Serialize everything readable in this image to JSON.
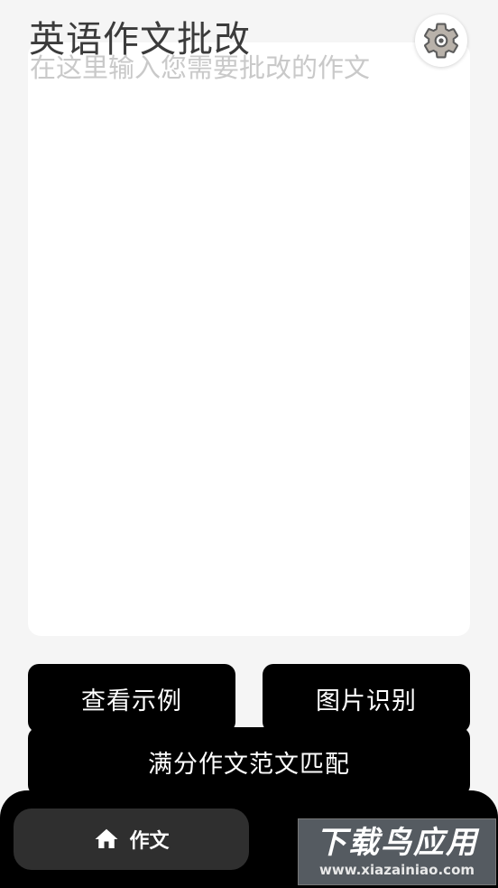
{
  "header": {
    "title": "英语作文批改",
    "settings_icon": "gear-icon"
  },
  "editor": {
    "placeholder": "在这里输入您需要批改的作文",
    "value": ""
  },
  "actions": {
    "example_label": "查看示例",
    "ocr_label": "图片识别",
    "match_label": "满分作文范文匹配"
  },
  "tabbar": {
    "active_tab": {
      "label": "作文",
      "icon": "home-icon"
    }
  },
  "watermark": {
    "title": "下载鸟应用",
    "url": "www.xiazainiao.com"
  },
  "colors": {
    "background": "#f5f5f5",
    "button": "#000000",
    "tab_active": "#2f2f2f",
    "placeholder": "#c9c9c9"
  }
}
